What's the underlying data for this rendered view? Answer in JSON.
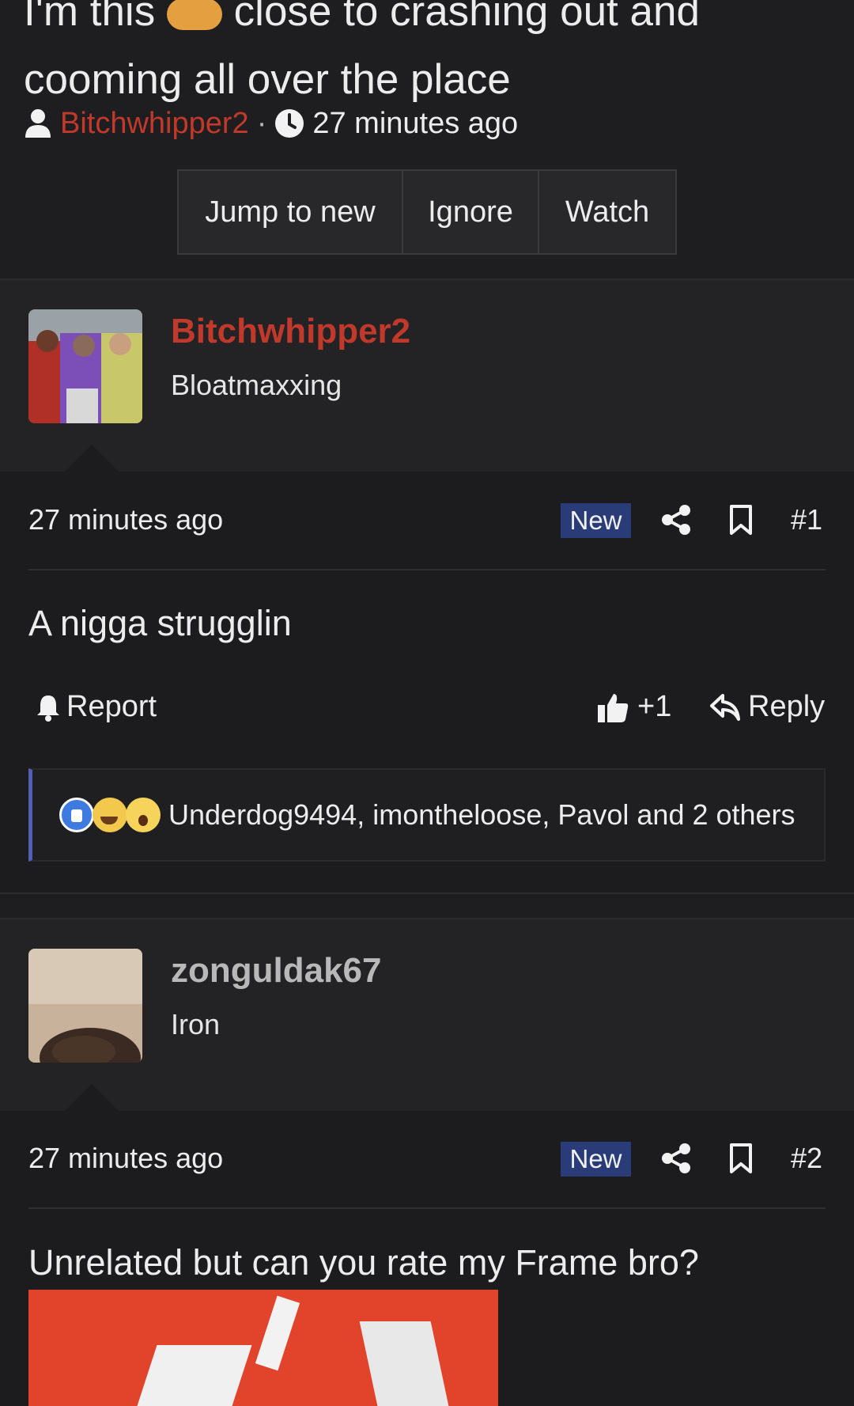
{
  "thread": {
    "title_line1": "I'm this",
    "title_line1_rest": "close to crashing out and",
    "title_line2": "cooming all over the place",
    "author": "Bitchwhipper2",
    "separator": "·",
    "time": "27 minutes ago"
  },
  "actions": {
    "jump": "Jump to new",
    "ignore": "Ignore",
    "watch": "Watch"
  },
  "posts": [
    {
      "username": "Bitchwhipper2",
      "username_color": "#c0392b",
      "user_title": "Bloatmaxxing",
      "time": "27 minutes ago",
      "badge": "New",
      "number": "#1",
      "message": "A nigga strugglin",
      "report": "Report",
      "like_count": "+1",
      "reply": "Reply",
      "reactions_text": "Underdog9494, imontheloose, Pavol and 2 others"
    },
    {
      "username": "zonguldak67",
      "username_color": "#b8b8b8",
      "user_title": "Iron",
      "time": "27 minutes ago",
      "badge": "New",
      "number": "#2",
      "message": "Unrelated but can you rate my Frame bro?"
    }
  ],
  "icons": [
    "user-icon",
    "clock-icon",
    "share-icon",
    "bookmark-icon",
    "bell-icon",
    "thumbs-up-icon",
    "reply-icon"
  ]
}
